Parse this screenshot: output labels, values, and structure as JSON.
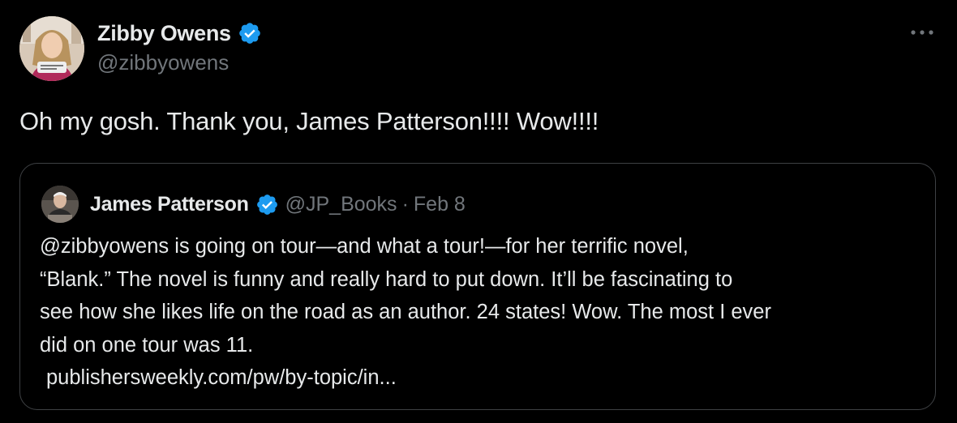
{
  "tweet": {
    "author": {
      "name": "Zibby Owens",
      "handle": "@zibbyowens",
      "verified": true,
      "avatar_icon": "profile-photo-avatar"
    },
    "more_icon": "more-horizontal-icon",
    "text": "Oh my gosh. Thank you, James Patterson!!!! Wow!!!!",
    "quoted_tweet": {
      "author": {
        "name": "James Patterson",
        "handle": "@JP_Books",
        "verified": true,
        "avatar_icon": "profile-photo-avatar"
      },
      "separator": "·",
      "date": "Feb 8",
      "lines": [
        "@zibbyowens is going on tour—and what a tour!—for her terrific novel,",
        "“Blank.” The novel is funny and really hard to put down. It’ll be fascinating to",
        "see how she likes life on the road as an author. 24 states! Wow. The most I ever",
        "did on one tour was 11."
      ],
      "link_text": "publishersweekly.com/pw/by-topic/in..."
    }
  },
  "colors": {
    "background": "#000000",
    "primary_text": "#e7e9ea",
    "secondary_text": "#71767b",
    "border": "#3e4144",
    "verified_badge": "#1d9bf0"
  }
}
